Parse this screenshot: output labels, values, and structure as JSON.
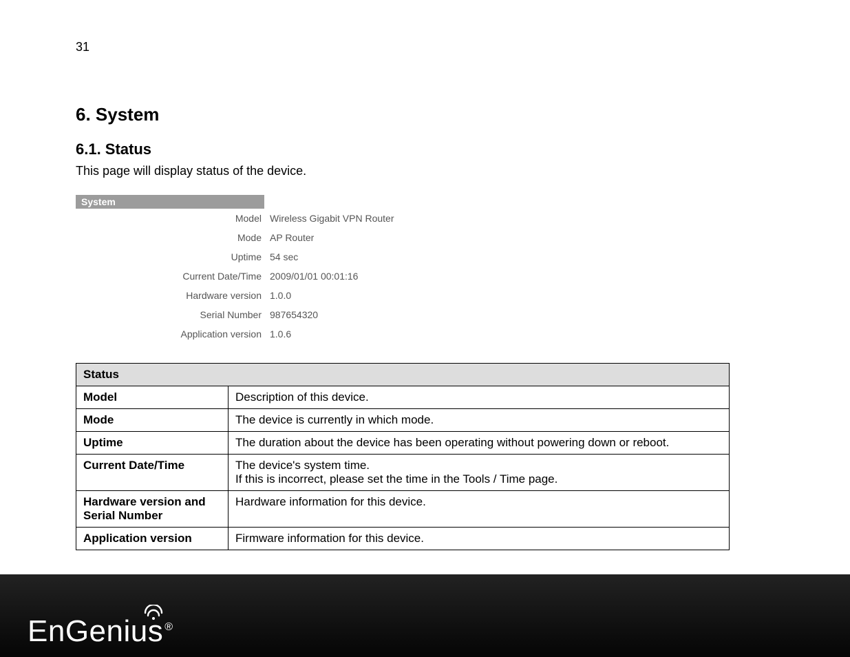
{
  "page_number": "31",
  "section_heading": "6. System",
  "subsection_heading": "6.1. Status",
  "intro_text": "This page will display status of the device.",
  "system_block": {
    "header": "System",
    "rows": [
      {
        "label": "Model",
        "value": "Wireless Gigabit VPN Router"
      },
      {
        "label": "Mode",
        "value": "AP Router"
      },
      {
        "label": "Uptime",
        "value": "54 sec"
      },
      {
        "label": "Current Date/Time",
        "value": "2009/01/01 00:01:16"
      },
      {
        "label": "Hardware version",
        "value": "1.0.0"
      },
      {
        "label": "Serial Number",
        "value": "987654320"
      },
      {
        "label": "Application version",
        "value": "1.0.6"
      }
    ]
  },
  "desc_table": {
    "header": "Status",
    "rows": [
      {
        "term": "Model",
        "desc": "Description of this device."
      },
      {
        "term": "Mode",
        "desc": "The device is currently in which mode."
      },
      {
        "term": "Uptime",
        "desc": "The duration about the device has been operating without powering down or reboot."
      },
      {
        "term": "Current Date/Time",
        "desc": "The device's system time.\nIf this is incorrect, please set the time in the Tools / Time page."
      },
      {
        "term": "Hardware version and Serial Number",
        "desc": "Hardware information for this device."
      },
      {
        "term": "Application version",
        "desc": "Firmware information for this device."
      }
    ]
  },
  "footer": {
    "brand": "EnGenius",
    "reg": "®"
  }
}
